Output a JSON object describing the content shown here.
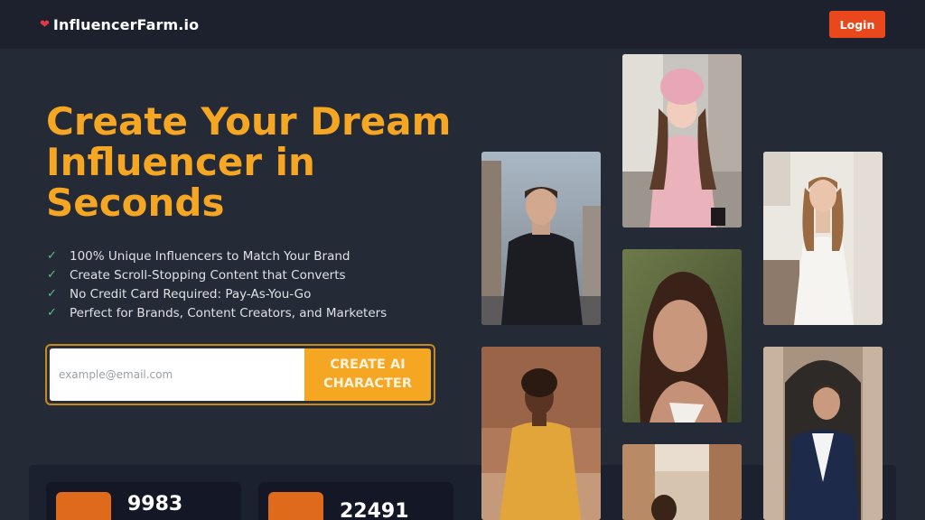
{
  "header": {
    "brand_name": "InfluencerFarm.io",
    "login_label": "Login"
  },
  "hero": {
    "title": "Create Your Dream Influencer in Seconds",
    "features": [
      "100% Unique Influencers to Match Your Brand",
      "Create Scroll-Stopping Content that Converts",
      "No Credit Card Required: Pay-As-You-Go",
      "Perfect for Brands, Content Creators, and Marketers"
    ],
    "email_placeholder": "example@email.com",
    "cta_label": "CREATE AI CHARACTER"
  },
  "stats": [
    {
      "value": "9983",
      "icon": "smiley-icon"
    },
    {
      "value": "22491",
      "icon": "camera-icon"
    }
  ],
  "colors": {
    "accent": "#f5a623",
    "login": "#e8481b",
    "check": "#5dc17a",
    "background": "#252a37",
    "header": "#1c212d"
  },
  "gallery": [
    {
      "icon": "photo-man-black-coat"
    },
    {
      "icon": "photo-woman-pink-beanie"
    },
    {
      "icon": "photo-woman-white-dress"
    },
    {
      "icon": "photo-woman-portrait"
    },
    {
      "icon": "photo-woman-yellow-dress"
    },
    {
      "icon": "photo-woman-street"
    },
    {
      "icon": "photo-man-blazer"
    }
  ]
}
